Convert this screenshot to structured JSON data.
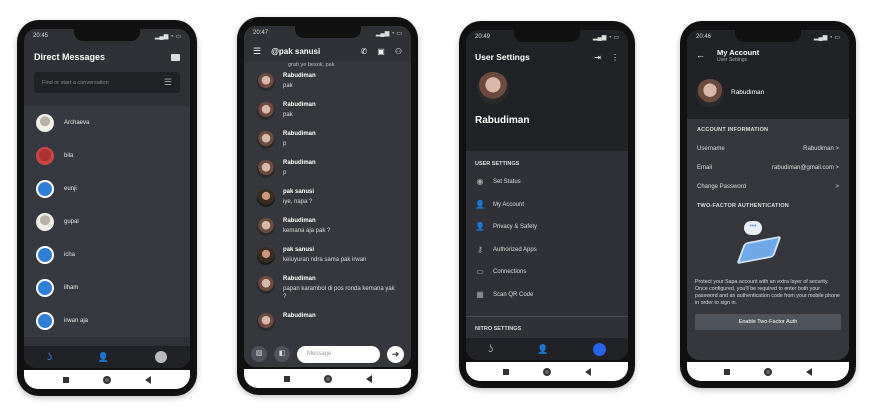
{
  "status": {
    "time1": "20:45",
    "time2": "20:47",
    "time3": "20:49",
    "time4": "20:46"
  },
  "dm": {
    "title": "Direct Messages",
    "search_placeholder": "Find or start a conversation",
    "contacts": [
      "Archaeva",
      "bila",
      "eunji",
      "gupal",
      "icha",
      "ilham",
      "irwan aja"
    ]
  },
  "chat": {
    "title": "@pak sanusi",
    "top_snippet": "grab ye besok, pak",
    "messages": [
      {
        "name": "Rabudiman",
        "text": "pak"
      },
      {
        "name": "Rabudiman",
        "text": "pak"
      },
      {
        "name": "Rabudiman",
        "text": "p"
      },
      {
        "name": "Rabudiman",
        "text": "p"
      },
      {
        "name": "pak sanusi",
        "text": "iye, napa ?"
      },
      {
        "name": "Rabudiman",
        "text": "kemana aja pak ?"
      },
      {
        "name": "pak sanusi",
        "text": "keluyuran ndra sama pak irwan"
      },
      {
        "name": "Rabudiman",
        "text": "papan karambol di pos ronda kemana yak ?"
      },
      {
        "name": "Rabudiman",
        "text": ""
      }
    ],
    "input_placeholder": "Message"
  },
  "settings": {
    "title": "User Settings",
    "username": "Rabudiman",
    "section": "USER SETTINGS",
    "items": [
      "Set Status",
      "My Account",
      "Privacy & Safety",
      "Authorized Apps",
      "Connections",
      "Scan QR Code"
    ],
    "nitro": "NITRO SETTINGS"
  },
  "account": {
    "title": "My Account",
    "subtitle": "User Settings",
    "username": "Rabudiman",
    "info_header": "ACCOUNT INFORMATION",
    "username_label": "Username",
    "username_value": "Rabudiman >",
    "email_label": "Email",
    "email_value": "rabudiman@gmail.com >",
    "password_label": "Change Password",
    "password_value": ">",
    "tfa_header": "TWO-FACTOR AUTHENTICATION",
    "tfa_desc": "Protect your Sapa account with an extra layer of security. Once configured, you'll be required to enter both your password and an authentication code from your mobile phone in order to sign in.",
    "tfa_button": "Enable Two-Factor Auth"
  }
}
